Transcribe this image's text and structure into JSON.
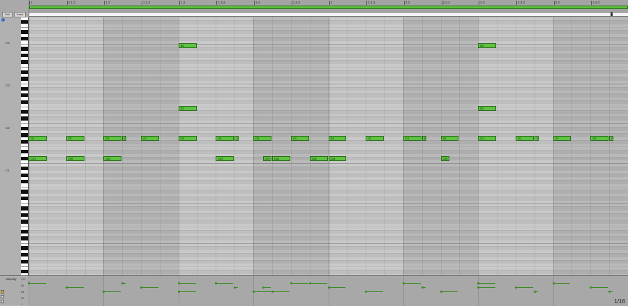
{
  "header": {
    "fold_label": "Fold",
    "scale_label": "Scale"
  },
  "timeline": {
    "beats": [
      "1",
      "1.1.3",
      "1.2",
      "1.2.3",
      "1.3",
      "1.3.3",
      "1.4",
      "1.4.3",
      "2",
      "2.1.3",
      "2.2",
      "2.2.3",
      "2.3",
      "2.3.3",
      "2.4",
      "2.4.3"
    ]
  },
  "keyboard": {
    "octave_labels": [
      "C4",
      "C3",
      "C2",
      "C1"
    ]
  },
  "notes": [
    {
      "label": "C#1",
      "row": "C#1",
      "start": 0.0,
      "len": 0.25
    },
    {
      "label": "C#1",
      "row": "C#1",
      "start": 0.5,
      "len": 0.25
    },
    {
      "label": "C#1",
      "row": "C#1",
      "start": 1.0,
      "len": 0.25
    },
    {
      "label": "C#1",
      "row": "C#1",
      "start": 2.5,
      "len": 0.25
    },
    {
      "label": "C#1",
      "row": "C#1",
      "start": 3.125,
      "len": 0.125
    },
    {
      "label": "C#1",
      "row": "C#1",
      "start": 3.25,
      "len": 0.25
    },
    {
      "label": "C#1",
      "row": "C#1",
      "start": 3.75,
      "len": 0.25
    },
    {
      "label": "C#1",
      "row": "C#1",
      "start": 4.0,
      "len": 0.25
    },
    {
      "label": "C#1",
      "row": "C#1",
      "start": 5.5,
      "len": 0.125
    },
    {
      "label": "G1",
      "row": "G1",
      "start": 0.0,
      "len": 0.25
    },
    {
      "label": "G1",
      "row": "G1",
      "start": 0.5,
      "len": 0.25
    },
    {
      "label": "G1",
      "row": "G1",
      "start": 1.0,
      "len": 0.25
    },
    {
      "label": "G",
      "row": "G1",
      "start": 1.25,
      "len": 0.0625
    },
    {
      "label": "G1",
      "row": "G1",
      "start": 1.5,
      "len": 0.25
    },
    {
      "label": "G1",
      "row": "G1",
      "start": 2.0,
      "len": 0.25
    },
    {
      "label": "G1",
      "row": "G1",
      "start": 2.5,
      "len": 0.25
    },
    {
      "label": "G",
      "row": "G1",
      "start": 2.75,
      "len": 0.0625
    },
    {
      "label": "G1",
      "row": "G1",
      "start": 3.0,
      "len": 0.25
    },
    {
      "label": "G1",
      "row": "G1",
      "start": 3.5,
      "len": 0.25
    },
    {
      "label": "G1",
      "row": "G1",
      "start": 4.0,
      "len": 0.25
    },
    {
      "label": "G1",
      "row": "G1",
      "start": 4.5,
      "len": 0.25
    },
    {
      "label": "G1",
      "row": "G1",
      "start": 5.0,
      "len": 0.25
    },
    {
      "label": "G",
      "row": "G1",
      "start": 5.25,
      "len": 0.0625
    },
    {
      "label": "G1",
      "row": "G1",
      "start": 5.5,
      "len": 0.25
    },
    {
      "label": "G1",
      "row": "G1",
      "start": 6.0,
      "len": 0.25
    },
    {
      "label": "G1",
      "row": "G1",
      "start": 6.5,
      "len": 0.25
    },
    {
      "label": "G",
      "row": "G1",
      "start": 6.75,
      "len": 0.0625
    },
    {
      "label": "G1",
      "row": "G1",
      "start": 7.0,
      "len": 0.25
    },
    {
      "label": "G1",
      "row": "G1",
      "start": 7.5,
      "len": 0.25
    },
    {
      "label": "G",
      "row": "G1",
      "start": 7.75,
      "len": 0.0625
    },
    {
      "label": "E2",
      "row": "E2",
      "start": 2.0,
      "len": 0.25
    },
    {
      "label": "E2",
      "row": "E2",
      "start": 6.0,
      "len": 0.25
    },
    {
      "label": "B3",
      "row": "B3",
      "start": 2.0,
      "len": 0.25
    },
    {
      "label": "B3",
      "row": "B3",
      "start": 6.0,
      "len": 0.25
    }
  ],
  "velocity": {
    "label": "Velocity",
    "scale_labels": [
      "127",
      "96",
      "64",
      "32",
      "1"
    ]
  },
  "status": {
    "quantize": "1/16"
  },
  "colors": {
    "note_fill": "#5ec341",
    "note_border": "#2a6d1c",
    "loop_bar": "#5fbf3d"
  }
}
